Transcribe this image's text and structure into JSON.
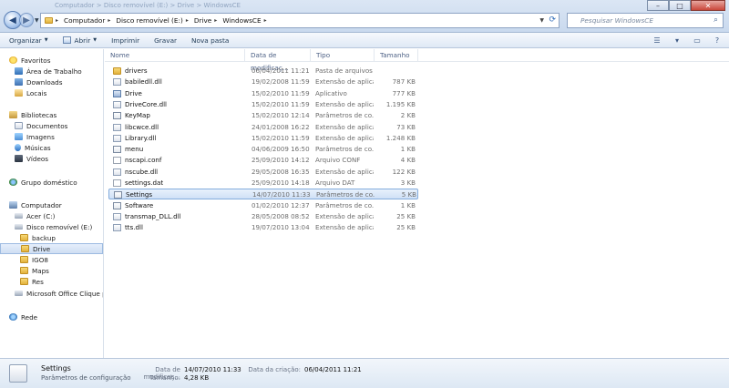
{
  "window": {
    "caption": "Computador > Disco removível (E:) > Drive > WindowsCE",
    "controls": {
      "minimize": "–",
      "maximize": "□",
      "close": "✕"
    }
  },
  "address": {
    "crumbs": [
      "Computador",
      "Disco removível (E:)",
      "Drive",
      "WindowsCE"
    ],
    "separator": "▸"
  },
  "search": {
    "placeholder": "Pesquisar WindowsCE"
  },
  "toolbar": {
    "organize": "Organizar",
    "open": "Abrir",
    "print": "Imprimir",
    "burn": "Gravar",
    "new_folder": "Nova pasta"
  },
  "nav": {
    "favorites": "Favoritos",
    "desktop": "Área de Trabalho",
    "downloads": "Downloads",
    "places": "Locais",
    "libraries": "Bibliotecas",
    "documents": "Documentos",
    "images": "Imagens",
    "music": "Músicas",
    "videos": "Vídeos",
    "homegroup": "Grupo doméstico",
    "computer": "Computador",
    "acer": "Acer (C:)",
    "removable": "Disco removível (E:)",
    "backup": "backup",
    "drive": "Drive",
    "igo8": "IGO8",
    "maps": "Maps",
    "res": "Res",
    "office": "Microsoft Office Clique pa",
    "network": "Rede"
  },
  "columns": {
    "name": "Nome",
    "date": "Data de modificaç...",
    "type": "Tipo",
    "size": "Tamanho"
  },
  "files": [
    {
      "name": "drivers",
      "date": "06/04/2011 11:21",
      "type": "Pasta de arquivos",
      "size": "",
      "icon": "folder"
    },
    {
      "name": "babiledll.dll",
      "date": "19/02/2008 11:59",
      "type": "Extensão de aplica...",
      "size": "787 KB",
      "icon": "dll"
    },
    {
      "name": "Drive",
      "date": "15/02/2010 11:59",
      "type": "Aplicativo",
      "size": "777 KB",
      "icon": "exe"
    },
    {
      "name": "DriveCore.dll",
      "date": "15/02/2010 11:59",
      "type": "Extensão de aplica...",
      "size": "1.195 KB",
      "icon": "dll"
    },
    {
      "name": "KeyMap",
      "date": "15/02/2010 12:14",
      "type": "Parâmetros de co...",
      "size": "2 KB",
      "icon": "cfg"
    },
    {
      "name": "libcwce.dll",
      "date": "24/01/2008 16:22",
      "type": "Extensão de aplica...",
      "size": "73 KB",
      "icon": "dll"
    },
    {
      "name": "Library.dll",
      "date": "15/02/2010 11:59",
      "type": "Extensão de aplica...",
      "size": "1.248 KB",
      "icon": "dll"
    },
    {
      "name": "menu",
      "date": "04/06/2009 16:50",
      "type": "Parâmetros de co...",
      "size": "1 KB",
      "icon": "cfg"
    },
    {
      "name": "nscapi.conf",
      "date": "25/09/2010 14:12",
      "type": "Arquivo CONF",
      "size": "4 KB",
      "icon": "file"
    },
    {
      "name": "nscube.dll",
      "date": "29/05/2008 16:35",
      "type": "Extensão de aplica...",
      "size": "122 KB",
      "icon": "dll"
    },
    {
      "name": "settings.dat",
      "date": "25/09/2010 14:18",
      "type": "Arquivo DAT",
      "size": "3 KB",
      "icon": "file"
    },
    {
      "name": "Settings",
      "date": "14/07/2010 11:33",
      "type": "Parâmetros de co...",
      "size": "5 KB",
      "icon": "cfg",
      "selected": true
    },
    {
      "name": "Software",
      "date": "01/02/2010 12:37",
      "type": "Parâmetros de co...",
      "size": "1 KB",
      "icon": "cfg"
    },
    {
      "name": "transmap_DLL.dll",
      "date": "28/05/2008 08:52",
      "type": "Extensão de aplica...",
      "size": "25 KB",
      "icon": "dll"
    },
    {
      "name": "tts.dll",
      "date": "19/07/2010 13:04",
      "type": "Extensão de aplica...",
      "size": "25 KB",
      "icon": "dll"
    }
  ],
  "details": {
    "name": "Settings",
    "type": "Parâmetros de configuração",
    "modified_label": "Data de modificaç...",
    "modified_value": "14/07/2010 11:33",
    "created_label": "Data da criação:",
    "created_value": "06/04/2011 11:21",
    "size_label": "Tamanho:",
    "size_value": "4,28 KB"
  }
}
